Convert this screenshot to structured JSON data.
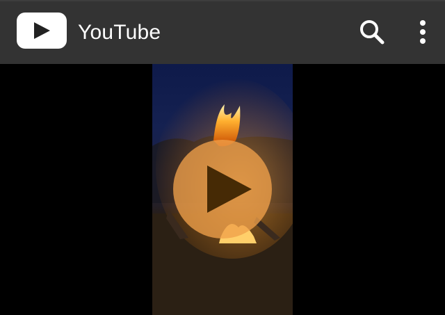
{
  "header": {
    "app_title": "YouTube",
    "logo_icon": "youtube-play-logo-icon",
    "search_icon": "search-icon",
    "menu_icon": "more-vert-icon"
  },
  "player": {
    "overlay_icon": "play-icon",
    "state": "paused"
  },
  "colors": {
    "topbar": "#333333",
    "background": "#000000",
    "title_text": "#ffffff",
    "icon": "#ffffff"
  }
}
